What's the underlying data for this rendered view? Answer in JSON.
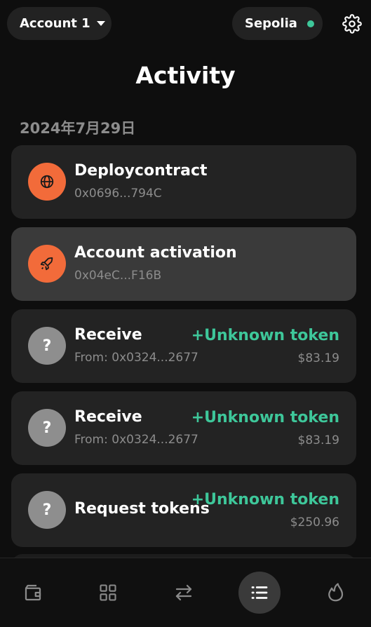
{
  "header": {
    "account_label": "Account 1",
    "network_label": "Sepolia",
    "network_status_color": "#3ec79a",
    "settings_icon": "gear-icon"
  },
  "page": {
    "title": "Activity"
  },
  "activity": {
    "date_heading": "2024年7月29日",
    "items": [
      {
        "title": "Deploycontract",
        "subtitle": "0x0696...794C",
        "icon": "globe-icon",
        "amount": "",
        "value": ""
      },
      {
        "title": "Account activation",
        "subtitle": "0x04eC...F16B",
        "icon": "rocket-icon",
        "amount": "",
        "value": ""
      },
      {
        "title": "Receive",
        "subtitle": "From: 0x0324...2677",
        "icon": "question-icon",
        "icon_text": "?",
        "amount": "+Unknown token",
        "value": "$83.19"
      },
      {
        "title": "Receive",
        "subtitle": "From: 0x0324...2677",
        "icon": "question-icon",
        "icon_text": "?",
        "amount": "+Unknown token",
        "value": "$83.19"
      },
      {
        "title": "Request tokens",
        "subtitle": "",
        "icon": "question-icon",
        "icon_text": "?",
        "amount": "+Unknown token",
        "value": "$250.96"
      }
    ]
  },
  "colors": {
    "accent_orange": "#f26b3a",
    "positive_green": "#3ec79a",
    "muted_text": "#8c8c8c"
  },
  "nav": {
    "items": [
      {
        "icon": "wallet-icon"
      },
      {
        "icon": "grid-icon"
      },
      {
        "icon": "swap-icon"
      },
      {
        "icon": "list-icon",
        "active": true
      },
      {
        "icon": "flame-icon"
      }
    ]
  }
}
